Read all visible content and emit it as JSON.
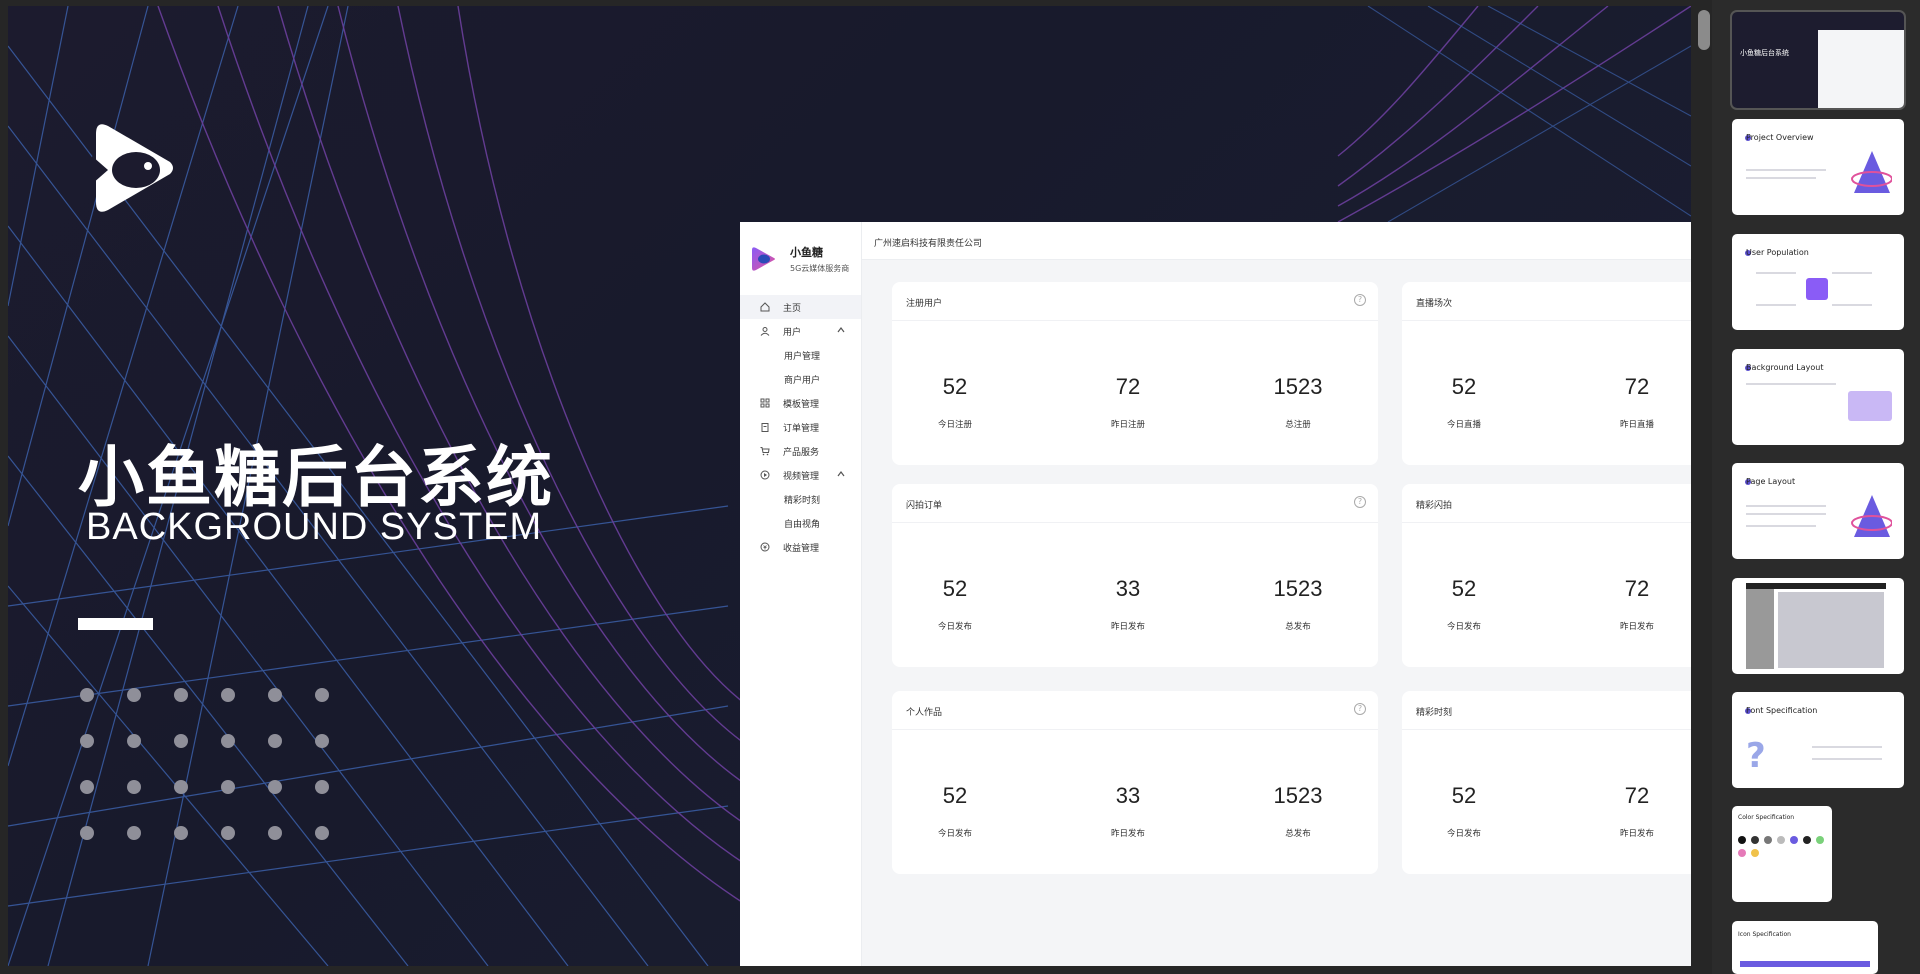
{
  "slide": {
    "title_cn": "小鱼糖后台系统",
    "title_en": "BACKGROUND SYSTEM"
  },
  "admin": {
    "brand_name": "小鱼糖",
    "brand_sub": "5G云媒体服务商",
    "company": "广州速启科技有限责任公司",
    "menu": [
      {
        "label": "主页",
        "icon": "home-icon",
        "active": true
      },
      {
        "label": "用户",
        "icon": "user-icon",
        "expanded": true
      },
      {
        "label": "用户管理",
        "sub": true
      },
      {
        "label": "商户用户",
        "sub": true
      },
      {
        "label": "模板管理",
        "icon": "grid-icon"
      },
      {
        "label": "订单管理",
        "icon": "clipboard-icon"
      },
      {
        "label": "产品服务",
        "icon": "cart-icon"
      },
      {
        "label": "视频管理",
        "icon": "play-icon",
        "expanded": true
      },
      {
        "label": "精彩时刻",
        "sub": true
      },
      {
        "label": "自由视角",
        "sub": true
      },
      {
        "label": "收益管理",
        "icon": "coin-icon"
      }
    ],
    "cards": [
      {
        "title": "注册用户",
        "stats": [
          {
            "value": "52",
            "label": "今日注册"
          },
          {
            "value": "72",
            "label": "昨日注册"
          },
          {
            "value": "1523",
            "label": "总注册"
          }
        ]
      },
      {
        "title": "直播场次",
        "stats": [
          {
            "value": "52",
            "label": "今日直播"
          },
          {
            "value": "72",
            "label": "昨日直播"
          }
        ]
      },
      {
        "title": "闪拍订单",
        "stats": [
          {
            "value": "52",
            "label": "今日发布"
          },
          {
            "value": "33",
            "label": "昨日发布"
          },
          {
            "value": "1523",
            "label": "总发布"
          }
        ]
      },
      {
        "title": "精彩闪拍",
        "stats": [
          {
            "value": "52",
            "label": "今日发布"
          },
          {
            "value": "72",
            "label": "昨日发布"
          }
        ]
      },
      {
        "title": "个人作品",
        "stats": [
          {
            "value": "52",
            "label": "今日发布"
          },
          {
            "value": "33",
            "label": "昨日发布"
          },
          {
            "value": "1523",
            "label": "总发布"
          }
        ]
      },
      {
        "title": "精彩时刻",
        "stats": [
          {
            "value": "52",
            "label": "今日发布"
          },
          {
            "value": "72",
            "label": "昨日发布"
          }
        ]
      }
    ],
    "help_glyph": "?"
  },
  "thumbnails": [
    {
      "title": "小鱼糖后台系统"
    },
    {
      "title": "Project Overview"
    },
    {
      "title": "User Population"
    },
    {
      "title": "Background Layout"
    },
    {
      "title": "Page Layout"
    },
    {
      "title": ""
    },
    {
      "title": "Font Specification"
    },
    {
      "title": "Color Specification"
    },
    {
      "title": "Icon Specification"
    }
  ],
  "colors": {
    "slide_bg": "#1c1b2e",
    "accent_purple": "#6a3f9a",
    "accent_blue": "#2f5ea8"
  }
}
